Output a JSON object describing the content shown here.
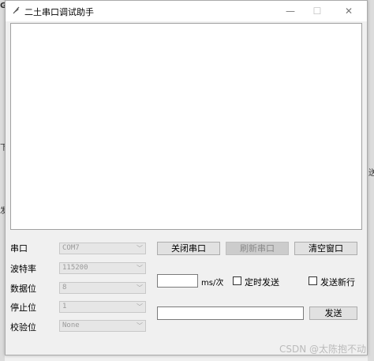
{
  "window": {
    "title": "二土串口调试助手"
  },
  "titlebar": {
    "minimize": "—",
    "maximize": "☐",
    "close": "✕"
  },
  "port_settings": {
    "serial_port": {
      "label": "串口",
      "value": "COM7"
    },
    "baud_rate": {
      "label": "波特率",
      "value": "115200"
    },
    "data_bits": {
      "label": "数据位",
      "value": "8"
    },
    "stop_bits": {
      "label": "停止位",
      "value": "1"
    },
    "parity": {
      "label": "校验位",
      "value": "None"
    }
  },
  "buttons": {
    "close_port": "关闭串口",
    "refresh_port": "刷新串口",
    "clear_window": "清空窗口",
    "send": "发送"
  },
  "timer": {
    "interval_value": "",
    "unit": "ms/次",
    "timed_send_label": "定时发送",
    "timed_send_checked": false
  },
  "newline": {
    "label": "发送新行",
    "checked": false
  },
  "send_input": {
    "value": ""
  },
  "background": {
    "left_top": "G",
    "left_mid": "下",
    "left_bot": "发",
    "right_mid": "送"
  },
  "watermark": "CSDN @太陈抱不动"
}
